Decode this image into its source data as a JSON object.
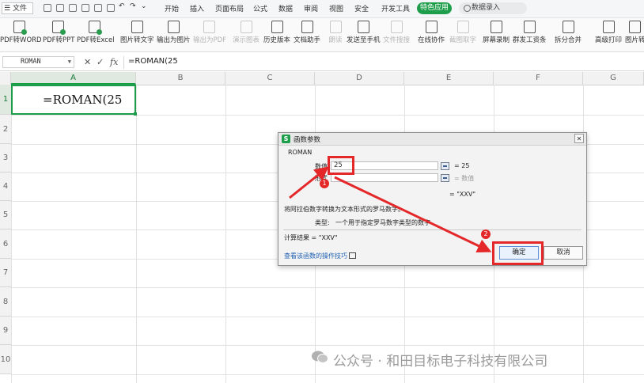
{
  "menubar": {
    "menu_icon": "hamburger-icon",
    "file_label": "文件",
    "tabs": [
      "开始",
      "插入",
      "页面布局",
      "公式",
      "数据",
      "审阅",
      "视图",
      "安全",
      "开发工具"
    ],
    "special_label": "特色应用",
    "search_placeholder": "数据录入"
  },
  "ribbon": {
    "buttons": [
      {
        "label": "PDF转WORD",
        "enabled": true
      },
      {
        "label": "PDF转PPT",
        "enabled": true
      },
      {
        "label": "PDF转Excel",
        "enabled": true
      },
      {
        "label": "图片转文字",
        "enabled": true
      },
      {
        "label": "输出为图片",
        "enabled": true
      },
      {
        "label": "输出为PDF",
        "enabled": false
      },
      {
        "label": "演示图表",
        "enabled": false
      },
      {
        "label": "历史版本",
        "enabled": true
      },
      {
        "label": "文档助手",
        "enabled": true
      },
      {
        "label": "朗读",
        "enabled": false
      },
      {
        "label": "发送至手机",
        "enabled": true
      },
      {
        "label": "文件搜搜",
        "enabled": false
      },
      {
        "label": "在线协作",
        "enabled": true
      },
      {
        "label": "截图取字",
        "enabled": false
      },
      {
        "label": "屏幕录制",
        "enabled": true
      },
      {
        "label": "群发工资条",
        "enabled": true
      },
      {
        "label": "拆分合并",
        "enabled": true
      },
      {
        "label": "高级打印",
        "enabled": true
      },
      {
        "label": "图片转",
        "enabled": true
      }
    ]
  },
  "formula_bar": {
    "name_box": "ROMAN",
    "cancel_glyph": "✕",
    "confirm_glyph": "✓",
    "fx_label": "fx",
    "formula": "=ROMAN(25"
  },
  "sheet": {
    "columns": [
      "A",
      "B",
      "C",
      "D",
      "E",
      "F",
      "G"
    ],
    "rows": [
      "1",
      "2",
      "3",
      "4",
      "5",
      "6",
      "7",
      "8",
      "9",
      "10"
    ],
    "active_cell_text": "=ROMAN(25",
    "accent_color": "#1e9e4a"
  },
  "dialog": {
    "title": "函数参数",
    "function_name": "ROMAN",
    "arg1_label": "数值",
    "arg1_value": "25",
    "arg1_result": "= 25",
    "arg2_label": "形式",
    "arg2_result": "= 数值",
    "formula_result_line": "= \"XXV\"",
    "description": "将阿拉伯数字转换为文本形式的罗马数字。",
    "type_label": "类型:",
    "type_description": "一个用于指定罗马数字类型的数字",
    "calc_result": "计算结果 = \"XXV\"",
    "help_link": "查看该函数的操作技巧",
    "ok_label": "确定",
    "cancel_label": "取消"
  },
  "annotations": {
    "marker_1": "1",
    "marker_2": "2",
    "color": "#e4282a"
  },
  "watermark": {
    "text": "公众号 · 和田目标电子科技有限公司",
    "icon": "wechat-icon"
  }
}
